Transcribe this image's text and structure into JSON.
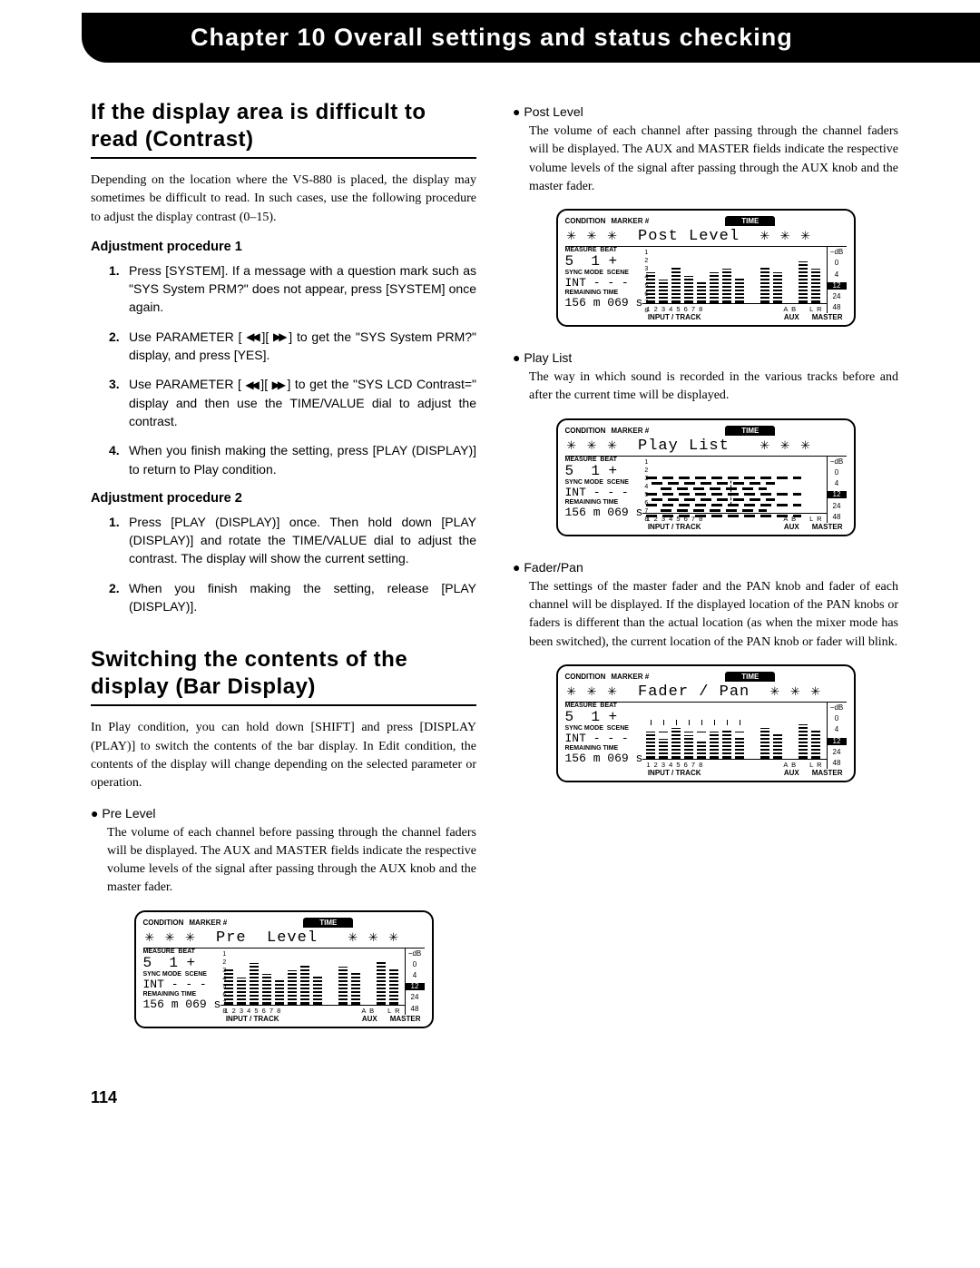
{
  "chapter": {
    "title": "Chapter 10  Overall settings and status checking"
  },
  "page_number": "114",
  "left": {
    "sec1": {
      "title": "If the display area is difficult to read (Contrast)",
      "intro": "Depending on the location where the VS-880 is placed, the display may sometimes be difficult to read. In such cases, use the following procedure to adjust the display contrast (0–15).",
      "proc1_heading": "Adjustment procedure 1",
      "proc1": {
        "s1": "Press [SYSTEM]. If a message with a question mark such as \"SYS System PRM?\" does not appear, press [SYSTEM] once again.",
        "s2a": "Use PARAMETER [ ",
        "s2b": " ][ ",
        "s2c": " ] to get the \"SYS System PRM?\" display, and press [YES].",
        "s3a": "Use PARAMETER [ ",
        "s3b": " ][ ",
        "s3c": " ] to get the \"SYS LCD Contrast=\" display and then use the TIME/VALUE dial to adjust the contrast.",
        "s4": "When you finish making the setting, press [PLAY (DISPLAY)] to return to Play condition."
      },
      "proc2_heading": "Adjustment procedure 2",
      "proc2": {
        "s1": "Press [PLAY (DISPLAY)] once. Then hold down [PLAY (DISPLAY)] and rotate the TIME/VALUE dial to adjust the contrast. The display will show the current setting.",
        "s2": "When you finish making the setting, release [PLAY (DISPLAY)]."
      }
    },
    "sec2": {
      "title": "Switching the contents of the display (Bar Display)",
      "intro": "In Play condition, you can hold down [SHIFT] and press [DISPLAY (PLAY)] to switch the contents of the bar display. In Edit condition, the contents of the display will change depending on the selected parameter or operation.",
      "pre_level": {
        "label": "Pre Level",
        "text": "The volume of each channel before passing through the channel faders will be displayed. The AUX and MASTER fields indicate the respective volume levels of the signal after passing through the AUX knob and the master fader."
      }
    }
  },
  "right": {
    "post_level": {
      "label": "Post Level",
      "text": "The volume of each channel after passing through the channel faders will be displayed. The AUX and MASTER fields indicate the respective volume levels of the signal after passing through the AUX knob and the master fader."
    },
    "play_list": {
      "label": "Play List",
      "text": "The way in which sound is recorded in the various tracks before and after the current time will be displayed."
    },
    "fader_pan": {
      "label": "Fader/Pan",
      "text": "The settings of the master fader and the PAN knob and fader of each channel will be displayed. If the displayed location of the PAN knobs or faders is different than the actual location (as when the mixer mode has been switched), the current location of the PAN knob or fader will blink."
    }
  },
  "lcd": {
    "condition": "CONDITION",
    "marker": "MARKER #",
    "time": "TIME",
    "measure": "MEASURE",
    "beat": "BEAT",
    "sync_mode": "SYNC MODE",
    "scene": "SCENE",
    "remaining": "REMAINING TIME",
    "input_track": "INPUT / TRACK",
    "aux": "AUX",
    "master": "MASTER",
    "db_neg": "−dB",
    "db0": "0",
    "db4": "4",
    "db12": "12",
    "db24": "24",
    "db48": "48",
    "stars": "✳ ✳ ✳",
    "meas_val": "5",
    "beat_val": "1",
    "int": "INT",
    "dashes": "- - -",
    "remaining_val": "156 m 069 s",
    "ch_nums": "1 2 3 4 5 6 7 8",
    "ab": "A B",
    "lr": "L R",
    "row_nums": {
      "r1": "1",
      "r2": "2",
      "r3": "3",
      "r4": "4",
      "r5": "5",
      "r6": "6",
      "r7": "7",
      "r8": "8"
    },
    "titles": {
      "pre": "Pre  Level",
      "post": "Post Level",
      "play": "Play List",
      "fader": "Fader / Pan"
    }
  }
}
